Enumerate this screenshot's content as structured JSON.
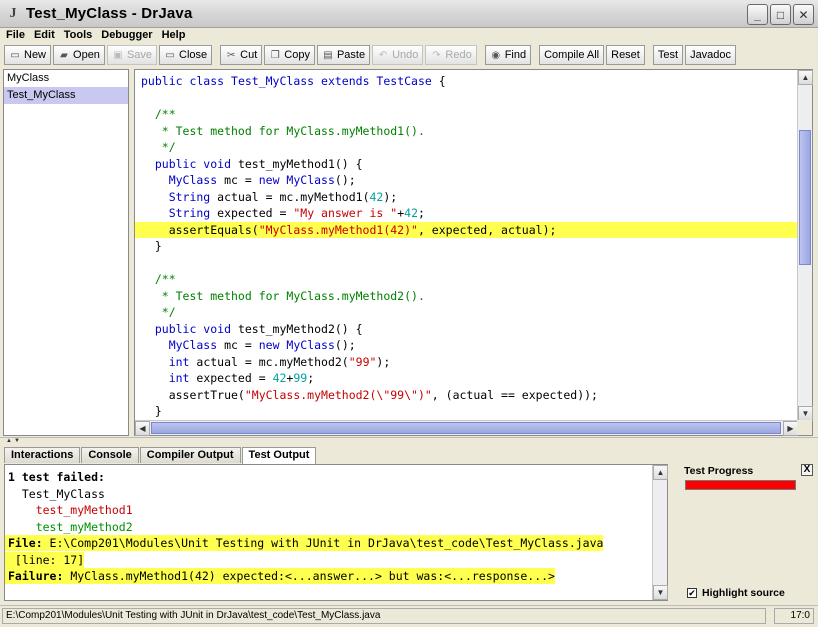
{
  "window": {
    "title": "Test_MyClass - DrJava",
    "logo_letter": "J"
  },
  "menu": [
    "File",
    "Edit",
    "Tools",
    "Debugger",
    "Help"
  ],
  "toolbar": {
    "new": "New",
    "open": "Open",
    "save": "Save",
    "close": "Close",
    "cut": "Cut",
    "copy": "Copy",
    "paste": "Paste",
    "undo": "Undo",
    "redo": "Redo",
    "find": "Find",
    "compile_all": "Compile All",
    "reset": "Reset",
    "test": "Test",
    "javadoc": "Javadoc"
  },
  "files": [
    "MyClass",
    "Test_MyClass"
  ],
  "selected_file": "Test_MyClass",
  "code": [
    [
      [
        "kw",
        "public class "
      ],
      [
        "kw",
        "Test_MyClass"
      ],
      [
        "kw",
        " extends "
      ],
      [
        "kw",
        "TestCase"
      ],
      [
        "pl",
        " {"
      ]
    ],
    [],
    [
      [
        "cm",
        "  /**"
      ]
    ],
    [
      [
        "cm",
        "   * Test method for MyClass.myMethod1()."
      ]
    ],
    [
      [
        "cm",
        "   */"
      ]
    ],
    [
      [
        "kw",
        "  public void "
      ],
      [
        "pl",
        "test_myMethod1() {"
      ]
    ],
    [
      [
        "kw",
        "    MyClass"
      ],
      [
        "pl",
        " mc = "
      ],
      [
        "kw",
        "new"
      ],
      [
        "kw",
        " MyClass"
      ],
      [
        "pl",
        "();"
      ]
    ],
    [
      [
        "kw",
        "    String"
      ],
      [
        "pl",
        " actual = mc.myMethod1("
      ],
      [
        "nu",
        "42"
      ],
      [
        "pl",
        ");"
      ]
    ],
    [
      [
        "kw",
        "    String"
      ],
      [
        "pl",
        " expected = "
      ],
      [
        "st",
        "\"My answer is \""
      ],
      [
        "pl",
        "+"
      ],
      [
        "nu",
        "42"
      ],
      [
        "pl",
        ";"
      ]
    ],
    [
      [
        "pl",
        "    assertEquals("
      ],
      [
        "st",
        "\"MyClass.myMethod1(42)\""
      ],
      [
        "pl",
        ", expected, actual);"
      ]
    ],
    [
      [
        "pl",
        "  }"
      ]
    ],
    [],
    [
      [
        "cm",
        "  /**"
      ]
    ],
    [
      [
        "cm",
        "   * Test method for MyClass.myMethod2()."
      ]
    ],
    [
      [
        "cm",
        "   */"
      ]
    ],
    [
      [
        "kw",
        "  public void "
      ],
      [
        "pl",
        "test_myMethod2() {"
      ]
    ],
    [
      [
        "kw",
        "    MyClass"
      ],
      [
        "pl",
        " mc = "
      ],
      [
        "kw",
        "new"
      ],
      [
        "kw",
        " MyClass"
      ],
      [
        "pl",
        "();"
      ]
    ],
    [
      [
        "kw",
        "    int"
      ],
      [
        "pl",
        " actual = mc.myMethod2("
      ],
      [
        "st",
        "\"99\""
      ],
      [
        "pl",
        ");"
      ]
    ],
    [
      [
        "kw",
        "    int"
      ],
      [
        "pl",
        " expected = "
      ],
      [
        "nu",
        "42"
      ],
      [
        "pl",
        "+"
      ],
      [
        "nu",
        "99"
      ],
      [
        "pl",
        ";"
      ]
    ],
    [
      [
        "pl",
        "    assertTrue("
      ],
      [
        "st",
        "\"MyClass.myMethod2(\\\"99\\\")\""
      ],
      [
        "pl",
        ", (actual == expected));"
      ]
    ],
    [
      [
        "pl",
        "  }"
      ]
    ]
  ],
  "highlighted_code_line": 9,
  "tabs": [
    "Interactions",
    "Console",
    "Compiler Output",
    "Test Output"
  ],
  "active_tab": "Test Output",
  "output": {
    "summary": "1 test failed:",
    "class": "  Test_MyClass",
    "method1": "    test_myMethod1",
    "method2": "    test_myMethod2",
    "file_label": "File:",
    "file_path": " E:\\Comp201\\Modules\\Unit Testing with JUnit in DrJava\\test_code\\Test_MyClass.java",
    "line_text": " [line: 17]",
    "failure_label": "Failure:",
    "failure_message": " MyClass.myMethod1(42) expected:<...answer...> but was:<...response...>"
  },
  "progress": {
    "title": "Test Progress",
    "close": "X",
    "fraction": 1.0,
    "color": "#ff0000",
    "highlight_label": "Highlight source",
    "highlight_checked": "✔"
  },
  "status": {
    "path": "E:\\Comp201\\Modules\\Unit Testing with JUnit in DrJava\\test_code\\Test_MyClass.java",
    "position": "17:0"
  },
  "icons": {
    "new": "document-icon",
    "open": "folder-icon",
    "save": "disk-icon",
    "close": "close-doc-icon",
    "cut": "scissors-icon",
    "copy": "copy-icon",
    "paste": "clipboard-icon",
    "undo": "undo-icon",
    "redo": "redo-icon",
    "find": "binoculars-icon"
  }
}
